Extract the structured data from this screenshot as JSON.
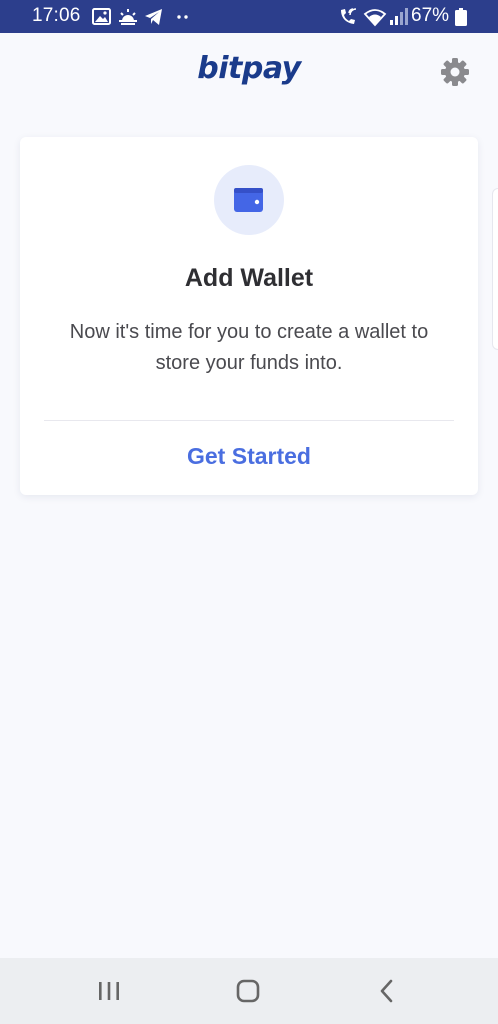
{
  "status_bar": {
    "time": "17:06",
    "battery": "67%",
    "left_icons": [
      "gallery-icon",
      "weather-icon",
      "telegram-icon",
      "more-dots-icon"
    ],
    "right_icons": [
      "wifi-call-icon",
      "wifi-icon",
      "signal-icon",
      "battery-icon"
    ]
  },
  "header": {
    "logo": "bitpay",
    "settings_icon": "gear-icon"
  },
  "card": {
    "icon": "wallet-icon",
    "title": "Add Wallet",
    "description": "Now it's time for you to create a wallet to store your funds into.",
    "action": "Get Started"
  },
  "nav_bar": {
    "buttons": [
      "recent-apps-icon",
      "home-icon",
      "back-icon"
    ]
  },
  "colors": {
    "status_bar": "#2c3e8c",
    "brand": "#1a3b8b",
    "accent": "#4a6ee0",
    "background": "#f8f9fd"
  }
}
